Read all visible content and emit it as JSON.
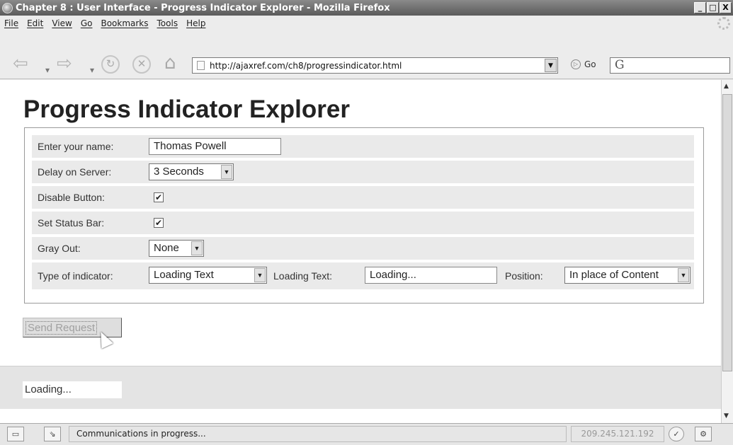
{
  "window": {
    "title": "Chapter 8 : User Interface - Progress Indicator Explorer - Mozilla Firefox",
    "controls": [
      "_",
      "□",
      "X"
    ]
  },
  "menu": {
    "items": [
      "File",
      "Edit",
      "View",
      "Go",
      "Bookmarks",
      "Tools",
      "Help"
    ]
  },
  "nav": {
    "url": "http://ajaxref.com/ch8/progressindicator.html",
    "go_label": "Go",
    "search_value": "G"
  },
  "page": {
    "heading": "Progress Indicator Explorer",
    "form": {
      "name_label": "Enter your name:",
      "name_value": "Thomas Powell",
      "delay_label": "Delay on Server:",
      "delay_value": "3 Seconds",
      "disable_label": "Disable Button:",
      "disable_checked": true,
      "status_label": "Set Status Bar:",
      "status_checked": true,
      "gray_label": "Gray Out:",
      "gray_value": "None",
      "indicator_label": "Type of indicator:",
      "indicator_value": "Loading Text",
      "loading_text_label": "Loading Text:",
      "loading_text_value": "Loading...",
      "position_label": "Position:",
      "position_value": "In place of Content"
    },
    "send_button": "Send Request",
    "loading_output": "Loading..."
  },
  "status": {
    "message": "Communications in progress...",
    "ip": "209.245.121.192"
  },
  "icons": {
    "checkbox_mark": "✔"
  }
}
